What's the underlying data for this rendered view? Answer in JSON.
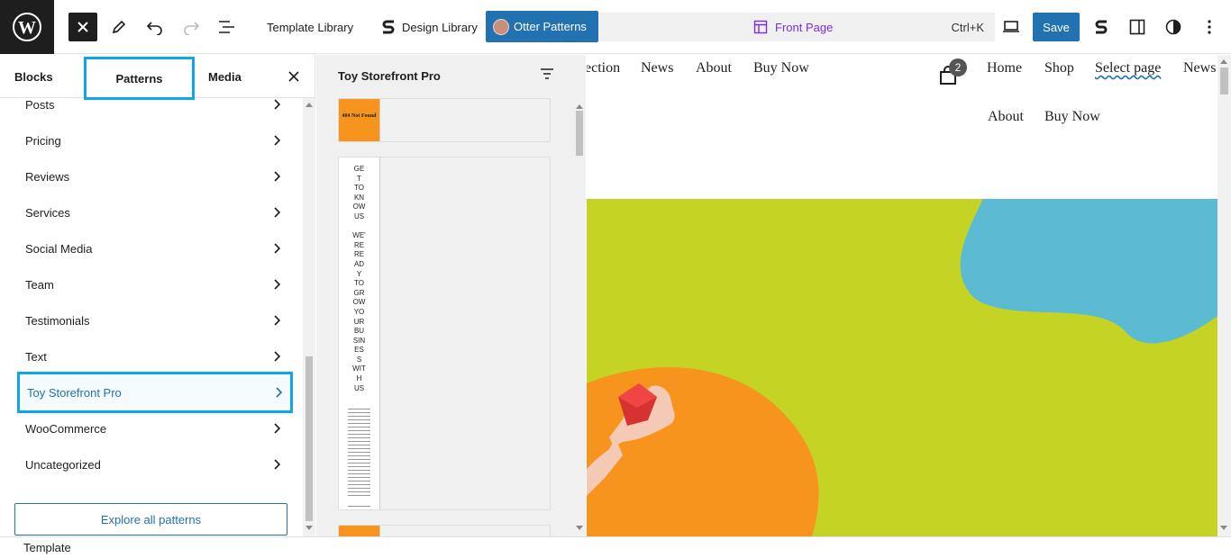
{
  "topbar": {
    "template_library": "Template Library",
    "design_library": "Design Library",
    "otter_patterns": "Otter Patterns",
    "page_title": "Front Page",
    "shortcut": "Ctrl+K",
    "save": "Save"
  },
  "inserter": {
    "tabs": [
      "Blocks",
      "Patterns",
      "Media"
    ],
    "categories": [
      "Posts",
      "Pricing",
      "Reviews",
      "Services",
      "Social Media",
      "Team",
      "Testimonials",
      "Text",
      "Toy Storefront Pro",
      "WooCommerce",
      "Uncategorized"
    ],
    "selected_category": "Toy Storefront Pro",
    "explore_label": "Explore all patterns"
  },
  "patterns": {
    "title": "Toy Storefront Pro",
    "card1_text": "404 Not Found",
    "card2_lines": [
      "GE",
      "T",
      "TO",
      "KN",
      "OW",
      "US",
      "",
      "WE'",
      "RE",
      "RE",
      "AD",
      "Y",
      "TO",
      "GR",
      "OW",
      "YO",
      "UR",
      "BU",
      "SIN",
      "ES",
      "S",
      "WIT",
      "H",
      "US"
    ]
  },
  "site": {
    "nav_left": [
      "ection",
      "News",
      "About",
      "Buy Now"
    ],
    "cart_count": "2",
    "nav_right": [
      "Home",
      "Shop",
      "Select page",
      "News"
    ],
    "nav_right_row2": [
      "About",
      "Buy Now"
    ]
  },
  "footer": {
    "label": "Template"
  },
  "colors": {
    "accent": "#2271b1",
    "focus": "#0ea5e9",
    "hero_green": "#c5d424",
    "hero_blue": "#5bbbd2",
    "hero_orange": "#f7941d",
    "purple": "#7a2ee0"
  }
}
